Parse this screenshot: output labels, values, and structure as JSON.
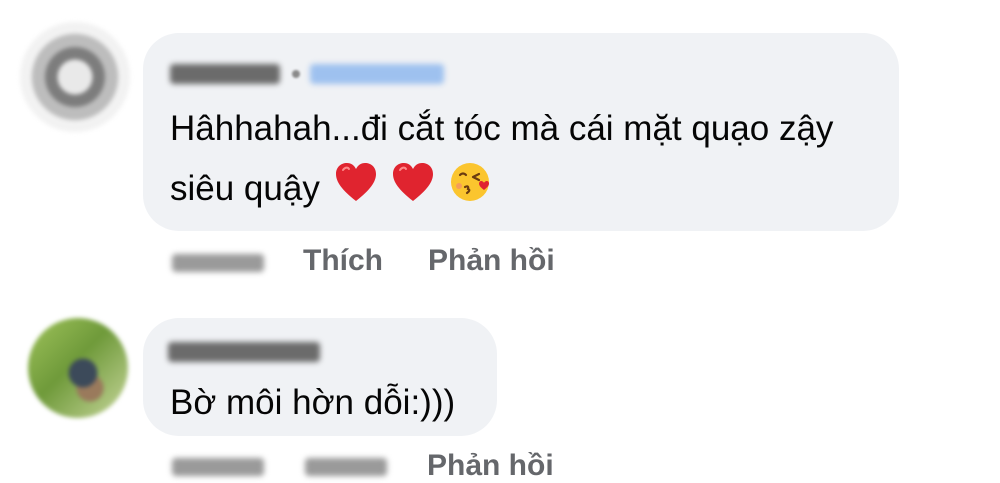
{
  "comments": [
    {
      "text_line1": "Hâhhahah...đi cắt tóc mà cái mặt quạo zậy",
      "text_line2": "siêu quậy",
      "emojis": [
        "red-heart",
        "red-heart",
        "face-blowing-kiss"
      ],
      "actions": {
        "like_label": "Thích",
        "reply_label": "Phản hồi"
      }
    },
    {
      "text": "Bờ môi hờn dỗi:)))",
      "actions": {
        "reply_label": "Phản hồi"
      }
    }
  ],
  "colors": {
    "bubble_bg": "#f0f2f5",
    "action_text": "#65676b",
    "body_text": "#050505"
  }
}
